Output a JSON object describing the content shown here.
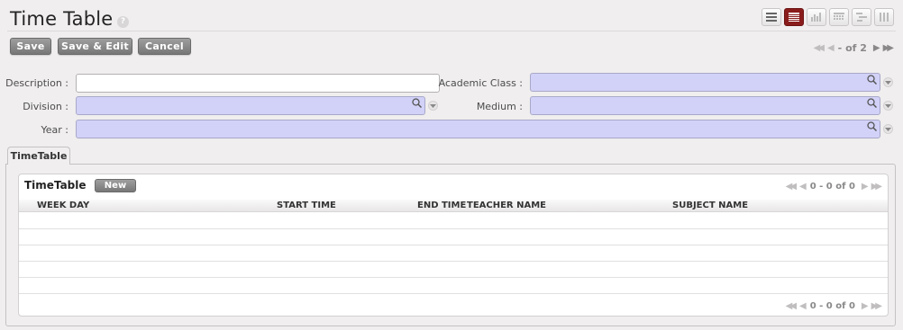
{
  "page": {
    "title": "Time Table",
    "help_glyph": "?"
  },
  "view_switcher": [
    {
      "name": "list-view-icon",
      "active": false
    },
    {
      "name": "form-view-icon",
      "active": true
    },
    {
      "name": "graph-view-icon",
      "active": false
    },
    {
      "name": "calendar-view-icon",
      "active": false
    },
    {
      "name": "gantt-view-icon",
      "active": false
    },
    {
      "name": "kanban-view-icon",
      "active": false
    }
  ],
  "toolbar": {
    "save_label": "Save",
    "save_edit_label": "Save & Edit",
    "cancel_label": "Cancel"
  },
  "record_pager": {
    "text": "- of 2"
  },
  "form": {
    "description_label": "Description :",
    "description_value": "",
    "academic_class_label": "Academic Class :",
    "academic_class_value": "",
    "division_label": "Division :",
    "division_value": "",
    "medium_label": "Medium :",
    "medium_value": "",
    "year_label": "Year :",
    "year_value": ""
  },
  "tabs": [
    {
      "label": "TimeTable"
    }
  ],
  "grid": {
    "title": "TimeTable",
    "new_label": "New",
    "pager_text": "0 - 0 of 0",
    "columns": [
      "WEEK DAY",
      "START TIME",
      "END TIME",
      "TEACHER NAME",
      "SUBJECT NAME"
    ],
    "rows": []
  },
  "colors": {
    "accent": "#8a1c1c",
    "button": "#8a8a8a",
    "many2one_bg": "#d2d2f9",
    "background": "#f0eeee"
  }
}
